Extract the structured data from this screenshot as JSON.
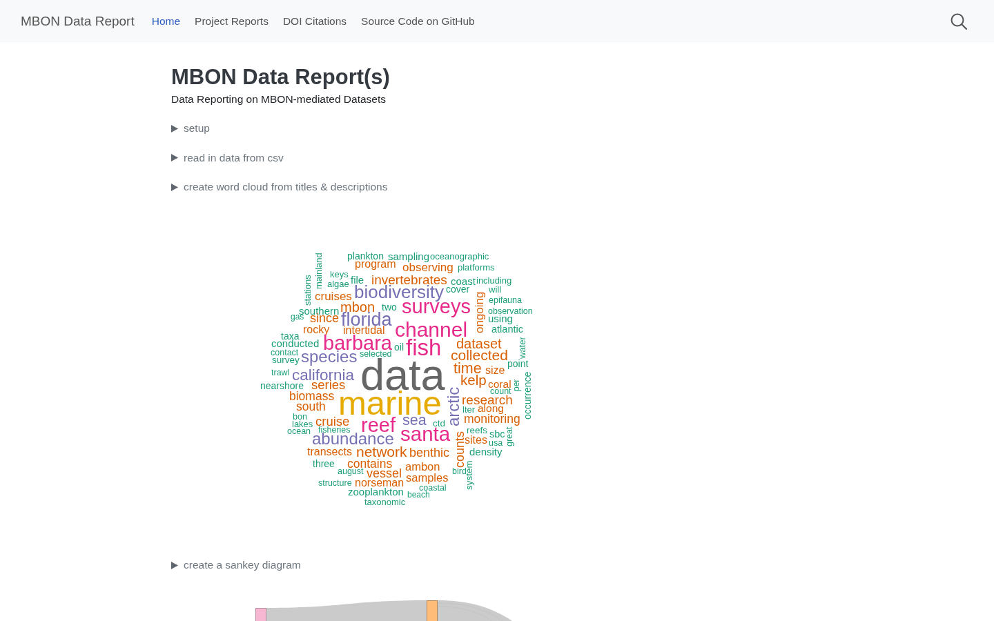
{
  "navbar": {
    "brand": "MBON Data Report",
    "links": [
      {
        "label": "Home",
        "selected": true
      },
      {
        "label": "Project Reports",
        "selected": false
      },
      {
        "label": "DOI Citations",
        "selected": false
      },
      {
        "label": "Source Code on GitHub",
        "selected": false
      }
    ]
  },
  "page": {
    "title": "MBON Data Report(s)",
    "subtitle": "Data Reporting on MBON-mediated Datasets"
  },
  "blocks": [
    {
      "kind": "details",
      "summary": "setup",
      "expanded": false
    },
    {
      "kind": "details",
      "summary": "read in data from csv",
      "expanded": false
    },
    {
      "kind": "details",
      "summary": "create word cloud from titles & descriptions",
      "expanded": false
    },
    {
      "kind": "word_cloud",
      "words": [
        {
          "text": "mainland",
          "color": "#1b9e77"
        },
        {
          "text": "plankton",
          "color": "#1b9e77"
        },
        {
          "text": "sampling",
          "color": "#1b9e77"
        },
        {
          "text": "oceanographic",
          "color": "#1b9e77"
        },
        {
          "text": "program",
          "color": "#d95f02"
        },
        {
          "text": "observing",
          "color": "#d95f02"
        },
        {
          "text": "platforms",
          "color": "#1b9e77"
        },
        {
          "text": "stations",
          "color": "#1b9e77"
        },
        {
          "text": "keys",
          "color": "#1b9e77"
        },
        {
          "text": "algae",
          "color": "#1b9e77"
        },
        {
          "text": "file",
          "color": "#1b9e77"
        },
        {
          "text": "invertebrates",
          "color": "#d95f02"
        },
        {
          "text": "coast",
          "color": "#1b9e77"
        },
        {
          "text": "including",
          "color": "#1b9e77"
        },
        {
          "text": "cruises",
          "color": "#d95f02"
        },
        {
          "text": "biodiversity",
          "color": "#7570b3"
        },
        {
          "text": "cover",
          "color": "#1b9e77"
        },
        {
          "text": "will",
          "color": "#1b9e77"
        },
        {
          "text": "epifauna",
          "color": "#1b9e77"
        },
        {
          "text": "southern",
          "color": "#1b9e77"
        },
        {
          "text": "mbon",
          "color": "#d95f02"
        },
        {
          "text": "two",
          "color": "#1b9e77"
        },
        {
          "text": "surveys",
          "color": "#e7298a"
        },
        {
          "text": "ongoing",
          "color": "#d95f02"
        },
        {
          "text": "observation",
          "color": "#1b9e77"
        },
        {
          "text": "gas",
          "color": "#1b9e77"
        },
        {
          "text": "since",
          "color": "#d95f02"
        },
        {
          "text": "florida",
          "color": "#7570b3"
        },
        {
          "text": "using",
          "color": "#1b9e77"
        },
        {
          "text": "taxa",
          "color": "#1b9e77"
        },
        {
          "text": "rocky",
          "color": "#d95f02"
        },
        {
          "text": "intertidal",
          "color": "#d95f02"
        },
        {
          "text": "channel",
          "color": "#e7298a"
        },
        {
          "text": "atlantic",
          "color": "#1b9e77"
        },
        {
          "text": "conducted",
          "color": "#1b9e77"
        },
        {
          "text": "contact",
          "color": "#1b9e77"
        },
        {
          "text": "barbara",
          "color": "#e7298a"
        },
        {
          "text": "survey",
          "color": "#1b9e77"
        },
        {
          "text": "species",
          "color": "#7570b3"
        },
        {
          "text": "selected",
          "color": "#1b9e77"
        },
        {
          "text": "oil",
          "color": "#1b9e77"
        },
        {
          "text": "fish",
          "color": "#e7298a"
        },
        {
          "text": "dataset",
          "color": "#d95f02"
        },
        {
          "text": "collected",
          "color": "#d95f02"
        },
        {
          "text": "water",
          "color": "#1b9e77"
        },
        {
          "text": "trawl",
          "color": "#1b9e77"
        },
        {
          "text": "california",
          "color": "#7570b3"
        },
        {
          "text": "nearshore",
          "color": "#1b9e77"
        },
        {
          "text": "series",
          "color": "#d95f02"
        },
        {
          "text": "data",
          "color": "#666666"
        },
        {
          "text": "time",
          "color": "#d95f02"
        },
        {
          "text": "size",
          "color": "#d95f02"
        },
        {
          "text": "point",
          "color": "#1b9e77"
        },
        {
          "text": "kelp",
          "color": "#d95f02"
        },
        {
          "text": "coral",
          "color": "#d95f02"
        },
        {
          "text": "per",
          "color": "#1b9e77"
        },
        {
          "text": "biomass",
          "color": "#d95f02"
        },
        {
          "text": "south",
          "color": "#d95f02"
        },
        {
          "text": "marine",
          "color": "#e6ab02"
        },
        {
          "text": "count",
          "color": "#1b9e77"
        },
        {
          "text": "arctic",
          "color": "#7570b3"
        },
        {
          "text": "research",
          "color": "#d95f02"
        },
        {
          "text": "lter",
          "color": "#1b9e77"
        },
        {
          "text": "along",
          "color": "#d95f02"
        },
        {
          "text": "bon",
          "color": "#1b9e77"
        },
        {
          "text": "lakes",
          "color": "#1b9e77"
        },
        {
          "text": "cruise",
          "color": "#d95f02"
        },
        {
          "text": "ocean",
          "color": "#1b9e77"
        },
        {
          "text": "fisheries",
          "color": "#1b9e77"
        },
        {
          "text": "reef",
          "color": "#e7298a"
        },
        {
          "text": "sea",
          "color": "#7570b3"
        },
        {
          "text": "ctd",
          "color": "#1b9e77"
        },
        {
          "text": "monitoring",
          "color": "#d95f02"
        },
        {
          "text": "occurrence",
          "color": "#1b9e77"
        },
        {
          "text": "abundance",
          "color": "#7570b3"
        },
        {
          "text": "santa",
          "color": "#e7298a"
        },
        {
          "text": "reefs",
          "color": "#1b9e77"
        },
        {
          "text": "sites",
          "color": "#d95f02"
        },
        {
          "text": "counts",
          "color": "#d95f02"
        },
        {
          "text": "sbc",
          "color": "#1b9e77"
        },
        {
          "text": "usa",
          "color": "#1b9e77"
        },
        {
          "text": "great",
          "color": "#1b9e77"
        },
        {
          "text": "transects",
          "color": "#d95f02"
        },
        {
          "text": "network",
          "color": "#d95f02"
        },
        {
          "text": "benthic",
          "color": "#d95f02"
        },
        {
          "text": "density",
          "color": "#1b9e77"
        },
        {
          "text": "three",
          "color": "#1b9e77"
        },
        {
          "text": "contains",
          "color": "#d95f02"
        },
        {
          "text": "august",
          "color": "#1b9e77"
        },
        {
          "text": "ambon",
          "color": "#d95f02"
        },
        {
          "text": "vessel",
          "color": "#d95f02"
        },
        {
          "text": "bird",
          "color": "#1b9e77"
        },
        {
          "text": "structure",
          "color": "#1b9e77"
        },
        {
          "text": "norseman",
          "color": "#d95f02"
        },
        {
          "text": "samples",
          "color": "#d95f02"
        },
        {
          "text": "system",
          "color": "#1b9e77"
        },
        {
          "text": "zooplankton",
          "color": "#1b9e77"
        },
        {
          "text": "coastal",
          "color": "#1b9e77"
        },
        {
          "text": "beach",
          "color": "#1b9e77"
        },
        {
          "text": "taxonomic",
          "color": "#1b9e77"
        }
      ]
    },
    {
      "kind": "details",
      "summary": "create a sankey diagram",
      "expanded": false
    },
    {
      "kind": "sankey"
    }
  ]
}
